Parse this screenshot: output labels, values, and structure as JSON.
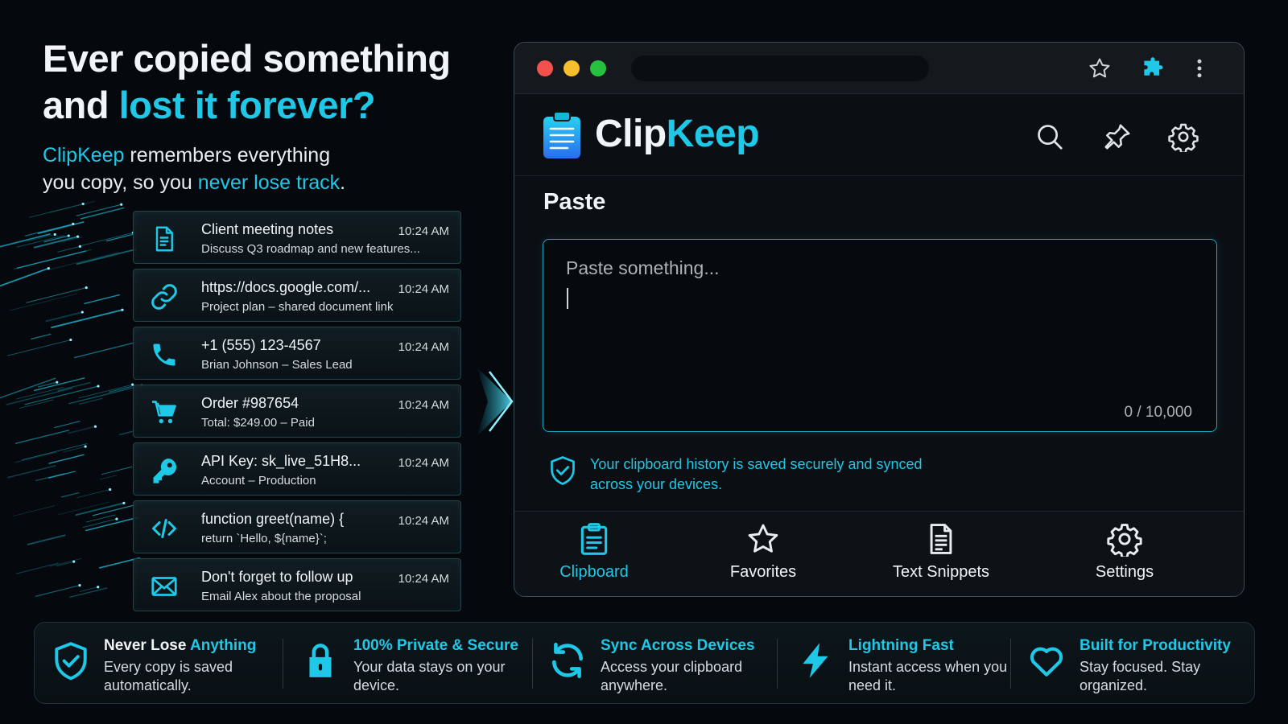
{
  "headline": {
    "line1": "Ever copied something",
    "line2_prefix": "and ",
    "line2_accent": "lost it forever?",
    "sub_brand": "ClipKeep",
    "sub_part1": " remembers everything",
    "sub_part2": "you copy, so you ",
    "sub_accent": "never lose track",
    "sub_end": "."
  },
  "clips": [
    {
      "icon": "document-icon",
      "title": "Client meeting notes",
      "sub": "Discuss Q3 roadmap and new features...",
      "time": "10:24 AM"
    },
    {
      "icon": "link-icon",
      "title": "https://docs.google.com/...",
      "sub": "Project plan – shared document link",
      "time": "10:24 AM"
    },
    {
      "icon": "phone-icon",
      "title": "+1 (555) 123-4567",
      "sub": "Brian Johnson – Sales Lead",
      "time": "10:24 AM"
    },
    {
      "icon": "cart-icon",
      "title": "Order #987654",
      "sub": "Total: $249.00 – Paid",
      "time": "10:24 AM"
    },
    {
      "icon": "key-icon",
      "title": "API Key: sk_live_51H8...",
      "sub": "Account – Production",
      "time": "10:24 AM"
    },
    {
      "icon": "code-icon",
      "title": "function greet(name) {",
      "sub": "  return `Hello, ${name}`;",
      "time": "10:24 AM"
    },
    {
      "icon": "mail-icon",
      "title": "Don't forget to follow up",
      "sub": "Email Alex about the proposal",
      "time": "10:24 AM"
    }
  ],
  "app": {
    "name_part1": "Clip",
    "name_part2": "Keep",
    "paste_title": "Paste",
    "paste_placeholder": "Paste something...",
    "paste_value": "",
    "counter": "0 / 10,000",
    "secure_note": "Your clipboard history is saved securely and synced across your devices."
  },
  "nav": [
    {
      "icon": "clipboard-icon",
      "label": "Clipboard",
      "active": true
    },
    {
      "icon": "star-icon",
      "label": "Favorites",
      "active": false
    },
    {
      "icon": "document-icon",
      "label": "Text Snippets",
      "active": false
    },
    {
      "icon": "gear-icon",
      "label": "Settings",
      "active": false
    }
  ],
  "features": [
    {
      "icon": "shield-check-icon",
      "title_plain": "Never Lose ",
      "title_accent": "Anything",
      "desc": "Every copy is saved automatically."
    },
    {
      "icon": "lock-icon",
      "title_plain": "",
      "title_accent": "100% Private & Secure",
      "desc": "Your data stays on your device."
    },
    {
      "icon": "sync-icon",
      "title_plain": "",
      "title_accent": "Sync Across Devices",
      "desc": "Access your clipboard anywhere."
    },
    {
      "icon": "bolt-icon",
      "title_plain": "",
      "title_accent": "Lightning Fast",
      "desc": "Instant access when you need it."
    },
    {
      "icon": "heart-icon",
      "title_plain": "",
      "title_accent": "Built for Productivity",
      "desc": "Stay focused. Stay organized."
    }
  ],
  "colors": {
    "accent": "#1ec8e6",
    "background": "#05080c",
    "traffic_red": "#f2514d",
    "traffic_yellow": "#f5bf2d",
    "traffic_green": "#27c140"
  }
}
